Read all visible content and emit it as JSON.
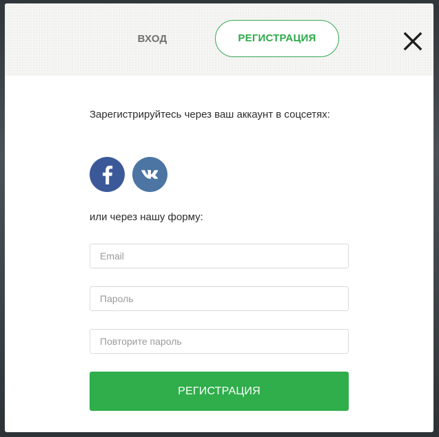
{
  "tabs": {
    "login_label": "ВХОД",
    "register_label": "РЕГИСТРАЦИЯ",
    "active": "register"
  },
  "close": {
    "icon": "close-icon"
  },
  "social": {
    "intro": "Зарегистрируйтесь через ваш аккаунт в соцсетях:",
    "buttons": [
      {
        "name": "facebook",
        "icon": "facebook-icon",
        "color": "#3b5998"
      },
      {
        "name": "vk",
        "icon": "vk-icon",
        "color": "#4c75a3"
      }
    ]
  },
  "form": {
    "or_text": "или через нашу форму:",
    "email_placeholder": "Email",
    "password_placeholder": "Пароль",
    "repeat_password_placeholder": "Повторите пароль",
    "email_value": "",
    "password_value": "",
    "repeat_password_value": "",
    "submit_label": "РЕГИСТРАЦИЯ"
  },
  "colors": {
    "accent_green": "#2fae4b",
    "header_bg": "#f5f5f3",
    "facebook_blue": "#3b5998",
    "vk_blue": "#4c75a3"
  }
}
